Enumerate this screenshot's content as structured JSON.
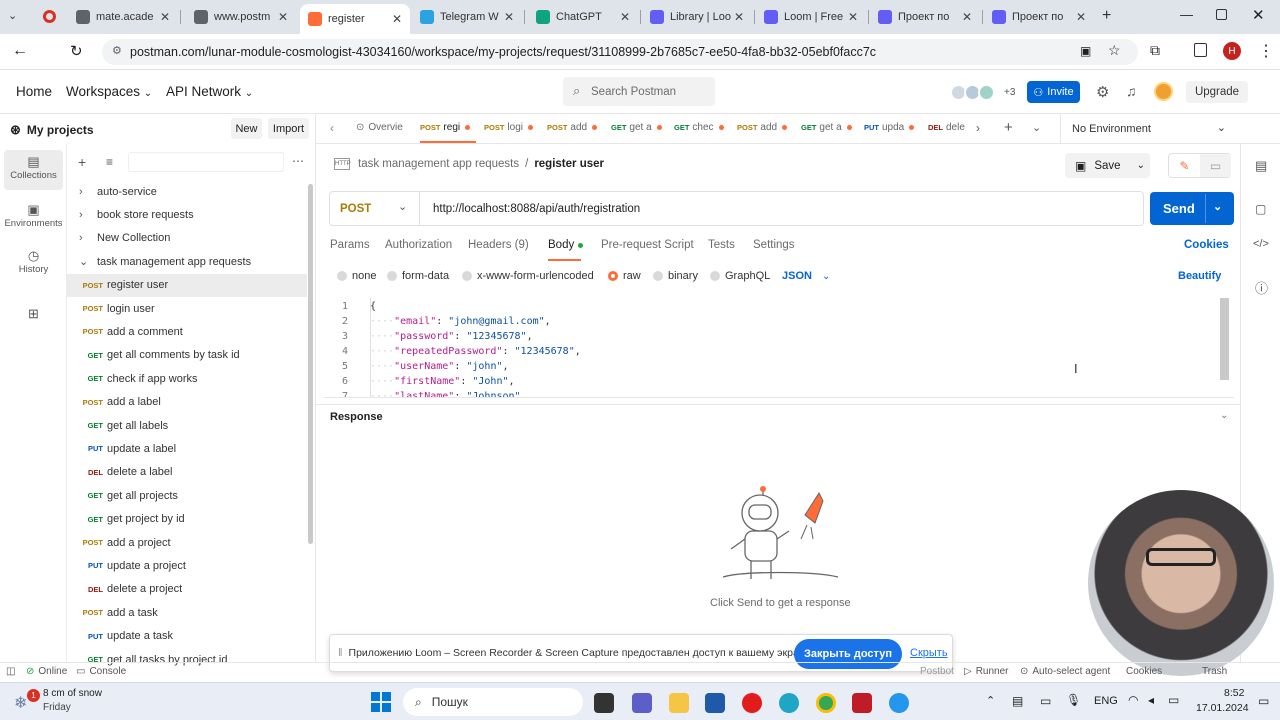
{
  "browser": {
    "tabs": [
      {
        "label": "mate.acade",
        "color": "#5f6368"
      },
      {
        "label": "www.postm",
        "color": "#5f6368"
      },
      {
        "label": "register",
        "color": "#ff6c37"
      },
      {
        "label": "Telegram W",
        "color": "#2aa3e0"
      },
      {
        "label": "ChatGPT",
        "color": "#10a37f"
      },
      {
        "label": "Library | Loo",
        "color": "#625df5"
      },
      {
        "label": "Loom | Free",
        "color": "#625df5"
      },
      {
        "label": "Проект по",
        "color": "#625df5"
      },
      {
        "label": "Проект по",
        "color": "#625df5"
      }
    ],
    "url": "postman.com/lunar-module-cosmologist-43034160/workspace/my-projects/request/31108999-2b7685c7-ee50-4fa8-bb32-05ebf0facc7c",
    "profile_initial": "H"
  },
  "header": {
    "home": "Home",
    "workspaces": "Workspaces",
    "api_network": "API Network",
    "search_placeholder": "Search Postman",
    "avatar_count": "+3",
    "invite": "Invite",
    "upgrade": "Upgrade"
  },
  "sidebar": {
    "title": "My projects",
    "new_label": "New",
    "import_label": "Import",
    "rail": [
      {
        "label": "Collections"
      },
      {
        "label": "Environments"
      },
      {
        "label": "History"
      }
    ],
    "collections": [
      {
        "label": "auto-service"
      },
      {
        "label": "book store requests"
      },
      {
        "label": "New Collection"
      },
      {
        "label": "task management app requests"
      }
    ],
    "requests": [
      {
        "method": "POST",
        "label": "register user"
      },
      {
        "method": "POST",
        "label": "login user"
      },
      {
        "method": "POST",
        "label": "add a comment"
      },
      {
        "method": "GET",
        "label": "get all comments by task id"
      },
      {
        "method": "GET",
        "label": "check if app works"
      },
      {
        "method": "POST",
        "label": "add a label"
      },
      {
        "method": "GET",
        "label": "get all labels"
      },
      {
        "method": "PUT",
        "label": "update a label"
      },
      {
        "method": "DEL",
        "label": "delete a label"
      },
      {
        "method": "GET",
        "label": "get all projects"
      },
      {
        "method": "GET",
        "label": "get project by id"
      },
      {
        "method": "POST",
        "label": "add a project"
      },
      {
        "method": "PUT",
        "label": "update a project"
      },
      {
        "method": "DEL",
        "label": "delete a project"
      },
      {
        "method": "POST",
        "label": "add a task"
      },
      {
        "method": "PUT",
        "label": "update a task"
      },
      {
        "method": "GET",
        "label": "get all tasks by project id"
      }
    ]
  },
  "request_tabs": [
    {
      "method": "",
      "label": "Overvie"
    },
    {
      "method": "POST",
      "label": "regi"
    },
    {
      "method": "POST",
      "label": "logi"
    },
    {
      "method": "POST",
      "label": "add"
    },
    {
      "method": "GET",
      "label": "get a"
    },
    {
      "method": "GET",
      "label": "chec"
    },
    {
      "method": "POST",
      "label": "add"
    },
    {
      "method": "GET",
      "label": "get a"
    },
    {
      "method": "PUT",
      "label": "upda"
    },
    {
      "method": "DEL",
      "label": "dele"
    }
  ],
  "environment": "No Environment",
  "breadcrumb": {
    "collection": "task management app requests",
    "separator": "/",
    "request": "register user"
  },
  "save_label": "Save",
  "request": {
    "method": "POST",
    "url": "http://localhost:8088/api/auth/registration",
    "send_label": "Send"
  },
  "req_tabs": {
    "params": "Params",
    "authorization": "Authorization",
    "headers": "Headers (9)",
    "body": "Body",
    "prerequest": "Pre-request Script",
    "tests": "Tests",
    "settings": "Settings",
    "cookies": "Cookies"
  },
  "body_types": {
    "none": "none",
    "form_data": "form-data",
    "urlencoded": "x-www-form-urlencoded",
    "raw": "raw",
    "binary": "binary",
    "graphql": "GraphQL",
    "format": "JSON",
    "beautify": "Beautify"
  },
  "code": [
    {
      "n": "1",
      "text": "{"
    },
    {
      "n": "2",
      "key": "\"email\"",
      "value": "\"john@gmail.com\""
    },
    {
      "n": "3",
      "key": "\"password\"",
      "value": "\"12345678\""
    },
    {
      "n": "4",
      "key": "\"repeatedPassword\"",
      "value": "\"12345678\""
    },
    {
      "n": "5",
      "key": "\"userName\"",
      "value": "\"john\""
    },
    {
      "n": "6",
      "key": "\"firstName\"",
      "value": "\"John\""
    },
    {
      "n": "7",
      "key": "\"lastName\"",
      "value": "\"Johnson\""
    }
  ],
  "response": {
    "title": "Response",
    "empty_text": "Click Send to get a response"
  },
  "loom_banner": {
    "text": "Приложению Loom – Screen Recorder & Screen Capture предоставлен доступ к вашему экрану.",
    "stop": "Закрыть доступ",
    "hide": "Скрыть"
  },
  "statusbar": {
    "online": "Online",
    "console": "Console",
    "postbot": "Postbot",
    "runner": "Runner",
    "auto_select": "Auto-select agent",
    "cookies": "Cookies",
    "trash": "Trash"
  },
  "taskbar": {
    "weather_temp": "8 cm of snow",
    "weather_day": "Friday",
    "weather_badge": "1",
    "search": "Пошук",
    "lang": "ENG",
    "time": "8:52",
    "date": "17.01.2024"
  },
  "colors": {
    "accent": "#ff6c37",
    "primary": "#0265d2"
  }
}
